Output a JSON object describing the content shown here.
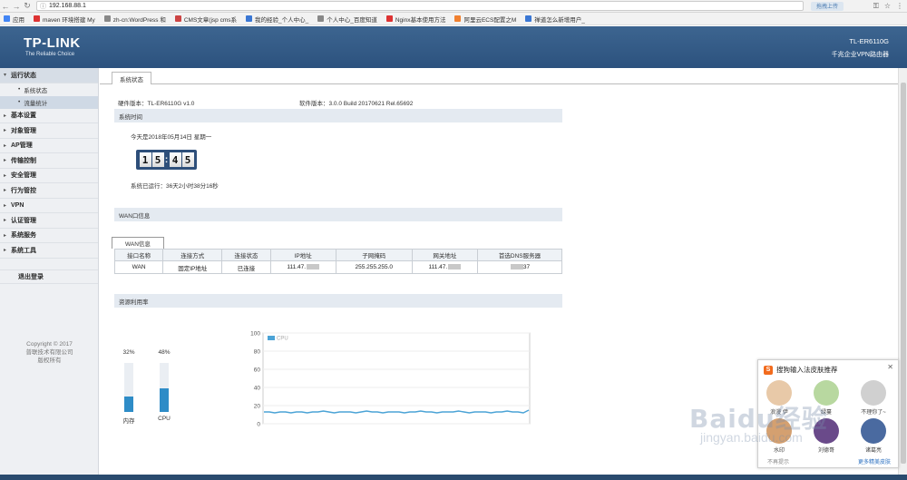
{
  "browser": {
    "url": "192.168.88.1",
    "ext_button": "拖拽上传",
    "bookmarks": [
      {
        "label": "应用",
        "color": "#4285f4"
      },
      {
        "label": "maven 环境搭建 My",
        "color": "#d33"
      },
      {
        "label": "zh-cn:WordPress 和",
        "color": "#888"
      },
      {
        "label": "CMS文章(jsp cms系",
        "color": "#c44"
      },
      {
        "label": "我的经验_个人中心_",
        "color": "#3a77d4"
      },
      {
        "label": "个人中心_百度知道",
        "color": "#888"
      },
      {
        "label": "Nginx基本使用方法",
        "color": "#d33"
      },
      {
        "label": "阿里云ECS配置之M",
        "color": "#f08030"
      },
      {
        "label": "禅道怎么新增用户_",
        "color": "#3a77d4"
      }
    ]
  },
  "header": {
    "logo": "TP-LINK",
    "slogan": "The Reliable Choice",
    "model": "TL-ER6110G",
    "model_desc": "千兆企业VPN路由器"
  },
  "sidebar": {
    "groups": [
      {
        "label": "运行状态",
        "active": true,
        "expanded": true,
        "children": [
          {
            "label": "系统状态",
            "active": false
          },
          {
            "label": "流量统计",
            "active": true
          }
        ]
      },
      {
        "label": "基本设置"
      },
      {
        "label": "对象管理"
      },
      {
        "label": "AP管理"
      },
      {
        "label": "传输控制"
      },
      {
        "label": "安全管理"
      },
      {
        "label": "行为管控"
      },
      {
        "label": "VPN"
      },
      {
        "label": "认证管理"
      },
      {
        "label": "系统服务"
      },
      {
        "label": "系统工具"
      }
    ],
    "logout": "退出登录",
    "copyright_line1": "Copyright © 2017",
    "copyright_line2": "普联技术有限公司",
    "copyright_line3": "版权所有"
  },
  "main": {
    "tab": "系统状态",
    "hardware": "硬件版本：TL-ER6110G v1.0",
    "software": "软件版本：3.0.0 Build 20170621 Rel.65692",
    "system_time_title": "系统时间",
    "date_text": "今天是2018年05月14日 星期一",
    "clock": [
      "1",
      "5",
      "4",
      "5"
    ],
    "uptime": "系统已运行：36天2小时38分16秒",
    "wan_title": "WAN口信息",
    "wan_tab": "WAN信息",
    "wan_table": {
      "headers": [
        "接口名称",
        "连接方式",
        "连接状态",
        "IP地址",
        "子网掩码",
        "网关地址",
        "首选DNS服务器"
      ],
      "rows": [
        [
          "WAN",
          "固定IP地址",
          "已连接",
          "111.47.",
          "255.255.255.0",
          "111.47.",
          "37"
        ]
      ]
    },
    "resource_title": "资源利用率",
    "memory": {
      "label": "内存",
      "percent_text": "32%",
      "value": 32
    },
    "cpu": {
      "label": "CPU",
      "percent_text": "48%",
      "value": 48
    }
  },
  "chart_data": {
    "type": "line",
    "title": "",
    "xlabel": "",
    "ylabel": "",
    "ylim": [
      0,
      100
    ],
    "yticks": [
      0,
      20,
      40,
      60,
      80,
      100
    ],
    "series": [
      {
        "name": "CPU",
        "color": "#4ba3d6",
        "values": [
          13,
          13,
          12,
          13,
          13,
          12,
          13,
          13,
          12,
          13,
          13,
          14,
          13,
          12,
          13,
          13,
          13,
          12,
          13,
          14,
          13,
          13,
          12,
          13,
          13,
          13,
          12,
          13,
          13,
          14,
          13,
          13,
          12,
          13,
          13,
          13,
          14,
          13,
          12,
          13,
          13,
          13,
          12,
          13,
          13,
          14,
          13,
          13,
          12,
          15
        ]
      }
    ]
  },
  "popup": {
    "title": "搜狗输入法皮肤推荐",
    "logo": "S",
    "skins": [
      {
        "label": "浪漫 伊",
        "color": "#e8c9a8"
      },
      {
        "label": "绿蔓",
        "color": "#b8d8a0"
      },
      {
        "label": "不理你了~",
        "color": "#d0d0d0"
      },
      {
        "label": "水印",
        "color": "#d4a070"
      },
      {
        "label": "刘德哥",
        "color": "#6a4a8a"
      },
      {
        "label": "诸葛亮",
        "color": "#4a6aa0"
      }
    ],
    "footer_left": "不再提示",
    "footer_right": "更多精美皮肤"
  },
  "watermark": {
    "line1": "Baidu经验",
    "line2": "jingyan.baidu.com"
  }
}
